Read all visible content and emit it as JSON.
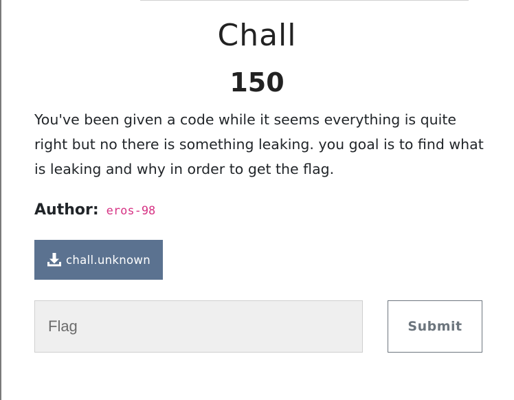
{
  "challenge": {
    "title": "Chall",
    "points": "150",
    "description": "You've been given a code while it seems everything is quite right but no there is something leaking. you goal is to find what is leaking and why in order to get the flag.",
    "author_label": "Author:",
    "author_name": "eros-98"
  },
  "files": [
    {
      "name": "chall.unknown",
      "icon": "download-icon"
    }
  ],
  "submission": {
    "input_placeholder": "Flag",
    "input_value": "",
    "submit_label": "Submit"
  },
  "colors": {
    "download_button_bg": "#5b7290",
    "author_code": "#d63384",
    "submit_border": "#6c757d",
    "input_bg": "#efefef"
  }
}
